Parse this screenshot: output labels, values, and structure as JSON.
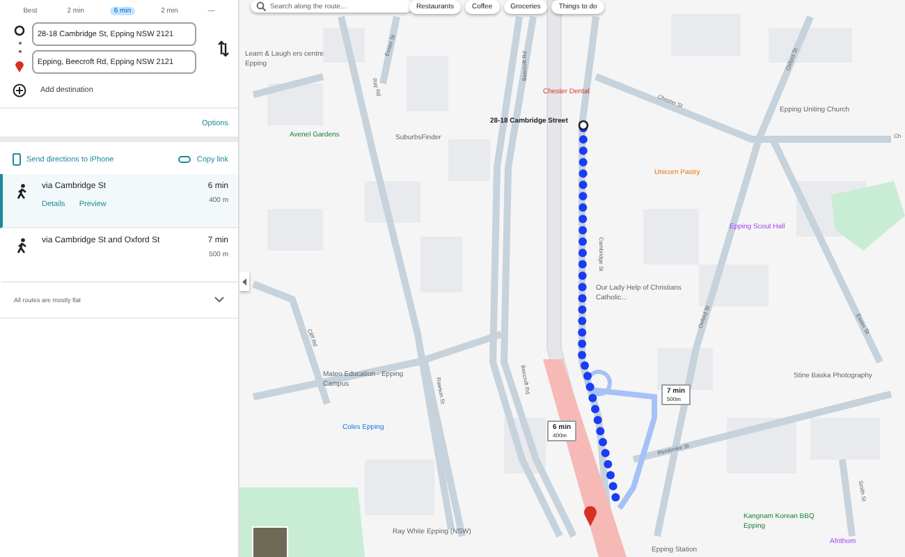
{
  "travel_modes": [
    {
      "label": "Best",
      "selected": false
    },
    {
      "label": "2 min",
      "selected": false
    },
    {
      "label": "6 min",
      "selected": true
    },
    {
      "label": "2 min",
      "selected": false
    },
    {
      "label": "—",
      "selected": false
    }
  ],
  "origin": {
    "value": "28-18 Cambridge St, Epping NSW 2121"
  },
  "destination": {
    "value": "Epping, Beecroft Rd, Epping NSW 2121"
  },
  "add_destination": "Add destination",
  "options": "Options",
  "send_directions": "Send directions to iPhone",
  "copy_link": "Copy link",
  "routes": [
    {
      "name": "via Cambridge St",
      "time": "6 min",
      "distance": "400 m",
      "selected": true,
      "links": [
        "Details",
        "Preview"
      ]
    },
    {
      "name": "via Cambridge St and Oxford St",
      "time": "7 min",
      "distance": "500 m",
      "selected": false
    }
  ],
  "route_note": "All routes are mostly flat",
  "map": {
    "search_placeholder": "Search along the route...",
    "chips": [
      "Restaurants",
      "Coffee",
      "Groceries",
      "Things to do"
    ],
    "places": [
      {
        "name": "Learn & Laugh ers centre Epping",
        "kind": "poi"
      },
      {
        "name": "Avenel Gardens",
        "kind": "park"
      },
      {
        "name": "SuburbsFinder",
        "kind": "poi"
      },
      {
        "name": "Chester Dental",
        "kind": "health"
      },
      {
        "name": "28-18 Cambridge Street",
        "kind": "origin"
      },
      {
        "name": "Epping Uniting Church",
        "kind": "poi"
      },
      {
        "name": "Unicorn Pastry",
        "kind": "food"
      },
      {
        "name": "Epping Scout Hall",
        "kind": "venue"
      },
      {
        "name": "Our Lady Help of Christians Catholic...",
        "kind": "poi"
      },
      {
        "name": "Mateo Education - Epping Campus",
        "kind": "poi"
      },
      {
        "name": "Stine Baska Photography",
        "kind": "poi"
      },
      {
        "name": "Coles Epping",
        "kind": "shop"
      },
      {
        "name": "Ray White Epping (NSW)",
        "kind": "poi"
      },
      {
        "name": "Kangnam Korean BBQ Epping",
        "kind": "park"
      },
      {
        "name": "Afrithom",
        "kind": "venue"
      },
      {
        "name": "Epping Station",
        "kind": "poi"
      }
    ],
    "streets": [
      "Ray Rd",
      "Essex St",
      "Chester St",
      "Oxford St",
      "Beecroft Rd",
      "Cambridge St",
      "Oxford St",
      "Essex St",
      "Cliff Rd",
      "Rawson St",
      "Beecroft Rd",
      "Pembroke St",
      "Smith St",
      "Ch"
    ],
    "route_labels": [
      {
        "time": "6 min",
        "distance": "400m"
      },
      {
        "time": "7 min",
        "distance": "500m"
      }
    ]
  }
}
